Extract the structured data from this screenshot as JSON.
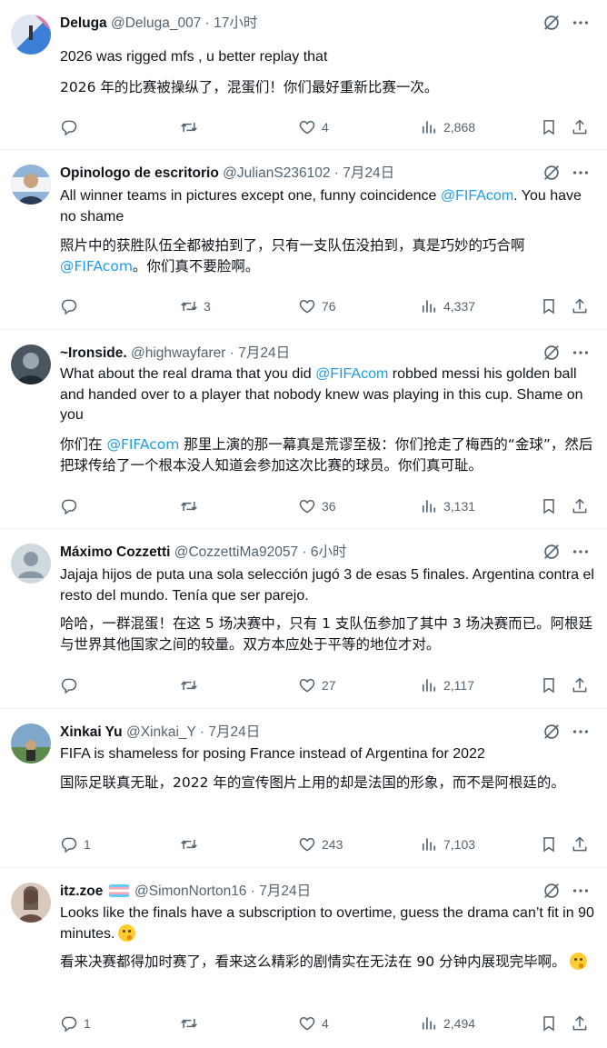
{
  "tweets": [
    {
      "name": "Deluga",
      "handle": "@Deluga_007",
      "time": "17小时",
      "text": "2026 was rigged mfs , u better replay that",
      "translation": "2026 年的比赛被操纵了，混蛋们！你们最好重新比赛一次。",
      "replies": "",
      "retweets": "",
      "likes": "4",
      "views": "2,868"
    },
    {
      "name": "Opinologo de escritorio",
      "handle": "@JulianS236102",
      "time": "7月24日",
      "text_before": "All winner teams in pictures except one, funny coincidence ",
      "text_mention": "@FIFAcom",
      "text_after": ". You have no shame",
      "translation_before": "照片中的获胜队伍全都被拍到了，只有一支队伍没拍到，真是巧妙的巧合啊",
      "translation_mention": "@FIFAcom",
      "translation_after": "。你们真不要脸啊。",
      "replies": "",
      "retweets": "3",
      "likes": "76",
      "views": "4,337"
    },
    {
      "name": "~Ironside.",
      "handle": "@highwayfarer",
      "time": "7月24日",
      "text_before": "What about the real drama that you did ",
      "text_mention": "@FIFAcom",
      "text_after": " robbed messi his golden ball and handed over to a player that nobody knew was playing in this cup. Shame on you",
      "translation_before": "你们在 ",
      "translation_mention": "@FIFAcom",
      "translation_after": " 那里上演的那一幕真是荒谬至极：你们抢走了梅西的“金球”，然后把球传给了一个根本没人知道会参加这次比赛的球员。你们真可耻。",
      "replies": "",
      "retweets": "",
      "likes": "36",
      "views": "3,131"
    },
    {
      "name": "Máximo Cozzetti",
      "handle": "@CozzettiMa92057",
      "time": "6小时",
      "text": "Jajaja hijos de puta una sola selección jugó 3 de esas 5 finales. Argentina contra el resto del mundo. Tenía que ser parejo.",
      "translation": "哈哈，一群混蛋！在这 5 场决赛中，只有 1 支队伍参加了其中 3 场决赛而已。阿根廷与世界其他国家之间的较量。双方本应处于平等的地位才对。",
      "replies": "",
      "retweets": "",
      "likes": "27",
      "views": "2,117"
    },
    {
      "name": "Xinkai Yu",
      "handle": "@Xinkai_Y",
      "time": "7月24日",
      "text": "FIFA is shameless for posing France instead of Argentina for 2022",
      "translation": "国际足联真无耻，2022 年的宣传图片上用的却是法国的形象，而不是阿根廷的。",
      "replies": "1",
      "retweets": "",
      "likes": "243",
      "views": "7,103"
    },
    {
      "name": "itz.zoe",
      "handle": "@SimonNorton16",
      "time": "7月24日",
      "text": "Looks like the finals have a subscription to overtime, guess the drama can’t fit in 90 minutes.",
      "translation": "看来决赛都得加时赛了，看来这么精彩的剧情实在无法在 90 分钟内展现完毕啊。",
      "replies": "1",
      "retweets": "",
      "likes": "4",
      "views": "2,494"
    }
  ],
  "separator": " · ",
  "colors": {
    "accent": "#1d9bf0",
    "muted": "#536471",
    "text": "#0f1419",
    "divider": "#eff3f4"
  },
  "icons": [
    "grok-icon",
    "more-icon",
    "reply-icon",
    "retweet-icon",
    "like-icon",
    "views-icon",
    "bookmark-icon",
    "share-icon",
    "trans-flag-icon",
    "thinking-emoji"
  ]
}
